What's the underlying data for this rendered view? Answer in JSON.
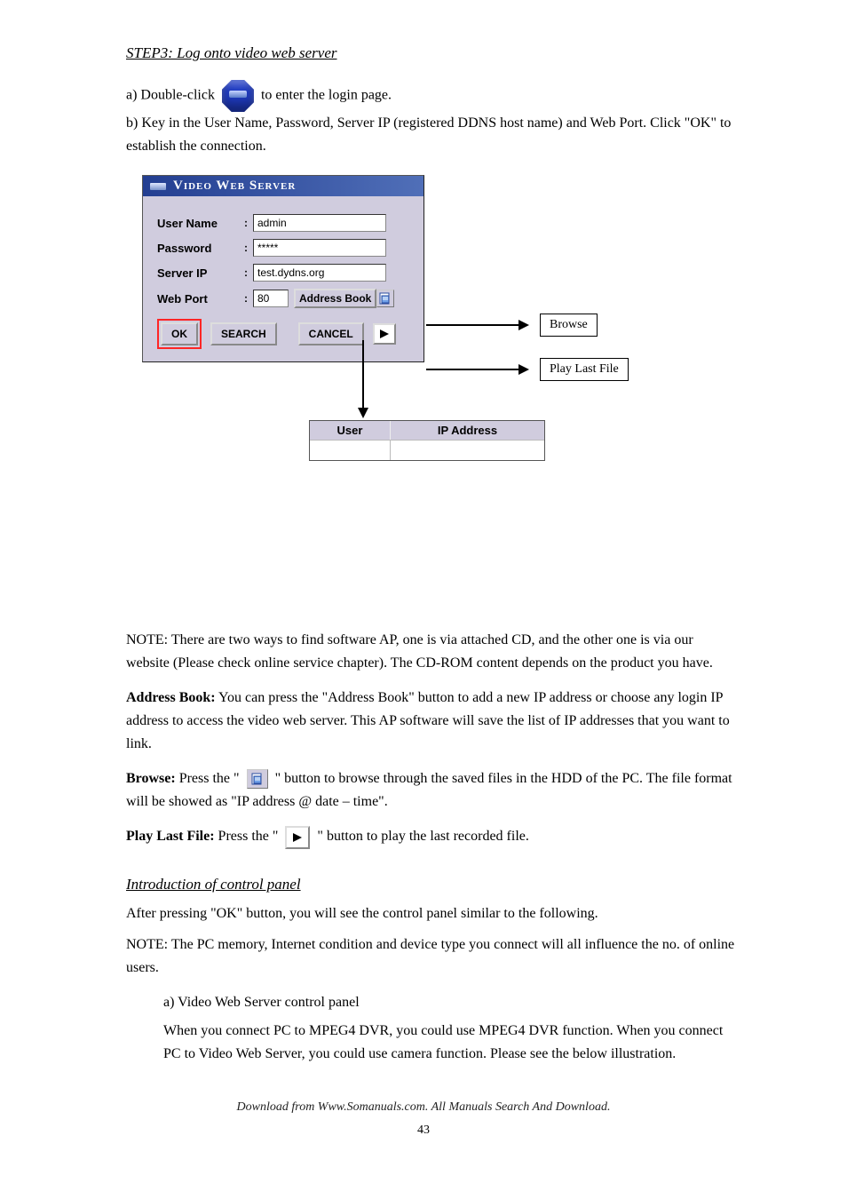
{
  "section1": {
    "title": "STEP3: Log onto video web server",
    "intro_line1_a": "a) Double-click",
    "intro_line1_b": "to enter the login page.",
    "intro_line2": "b) Key in the User Name, Password, Server IP (registered DDNS host name) and Web Port. Click \"OK\" to establish the connection."
  },
  "dialog": {
    "title": "Video Web Server",
    "labels": {
      "user": "User Name",
      "pass": "Password",
      "server": "Server IP",
      "port": "Web Port"
    },
    "values": {
      "user": "admin",
      "pass": "*****",
      "server": "test.dydns.org",
      "port": "80"
    },
    "buttons": {
      "addrbook": "Address Book",
      "ok": "OK",
      "search": "SEARCH",
      "cancel": "CANCEL"
    }
  },
  "callouts": {
    "browse": "Browse",
    "play": "Play Last File"
  },
  "addr_table": {
    "col_user": "User",
    "col_ip": "IP Address"
  },
  "notes": {
    "n1": "NOTE: There are two ways to find software AP, one is via attached CD, and the other one is via our website (Please check online service chapter). The CD-ROM content depends on the product you have.",
    "ab_lead": "Address Book:",
    "ab_body": "You can press the \"Address Book\" button to add a new IP address or choose any login IP address to access the video web server. This AP software will save the list of IP addresses that you want to link.",
    "browse_lead": "Browse:",
    "browse_body_a": "Press the \"",
    "browse_body_b": "\" button to browse through the saved files in the HDD of the PC. The file format will be showed as \"IP address @ date – time\".",
    "play_lead": "Play Last File:",
    "play_body_a": "Press the \"",
    "play_body_b": "\" button to play the last recorded file."
  },
  "section2": {
    "title": "Introduction of control panel",
    "line1": "After pressing \"OK\" button, you will see the control panel similar to the following.",
    "note": "NOTE: The PC memory, Internet condition and device type you connect will all influence the no. of online users.",
    "a_lead": "a) Video Web Server control panel",
    "a_body": "When you connect PC to MPEG4 DVR, you could use MPEG4 DVR function. When you connect PC to Video Web Server, you could use camera function. Please see the below illustration."
  },
  "footer": {
    "hint_line": "Download from Www.Somanuals.com. All Manuals Search And Download.",
    "page_no": "43"
  }
}
